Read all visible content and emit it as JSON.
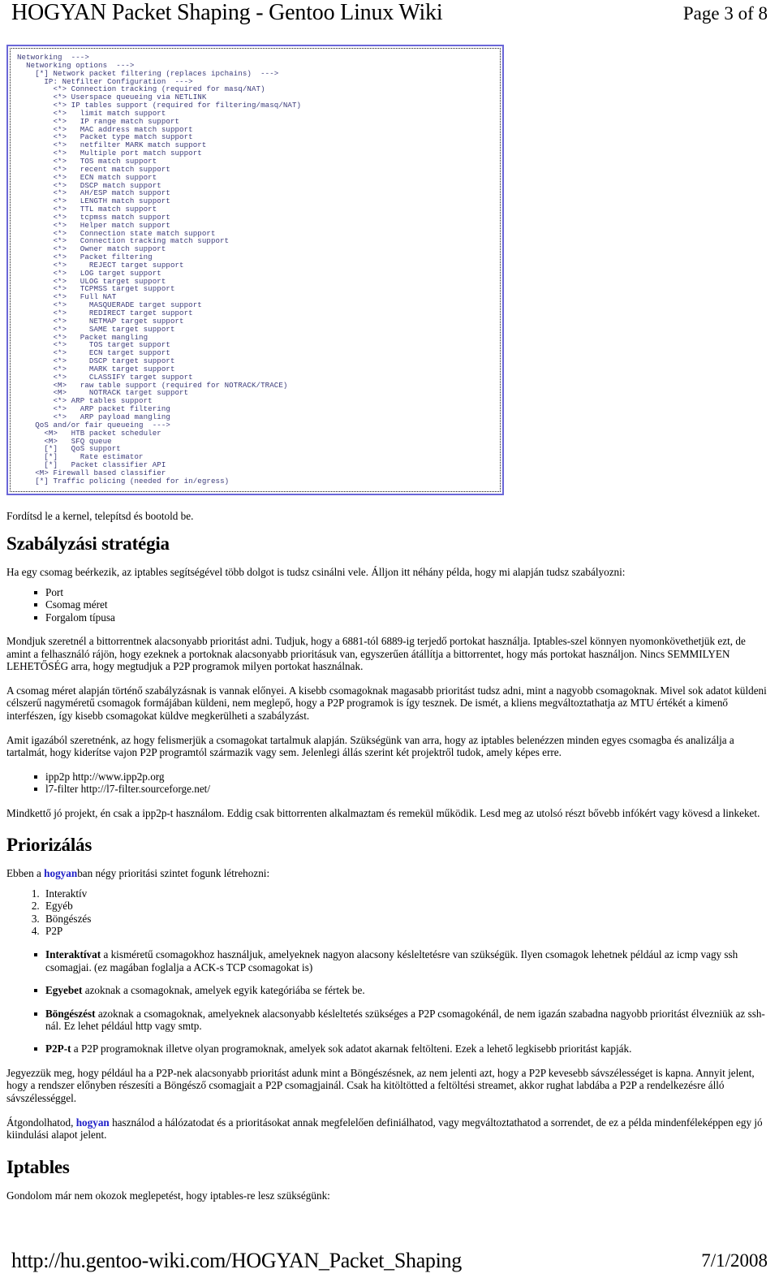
{
  "header": {
    "title": "HOGYAN Packet Shaping - Gentoo Linux Wiki",
    "page_label": "Page 3 of 8"
  },
  "codeblock": {
    "name": "kernel-menuconfig-listing",
    "text_color": "#3b3b7a",
    "border_color": "#6a66d8",
    "content": "Networking  --->\n  Networking options  --->\n    [*] Network packet filtering (replaces ipchains)  --->\n      IP: Netfilter Configuration  --->\n        <*> Connection tracking (required for masq/NAT)\n        <*> Userspace queueing via NETLINK\n        <*> IP tables support (required for filtering/masq/NAT)\n        <*>   limit match support\n        <*>   IP range match support\n        <*>   MAC address match support\n        <*>   Packet type match support\n        <*>   netfilter MARK match support\n        <*>   Multiple port match support\n        <*>   TOS match support\n        <*>   recent match support\n        <*>   ECN match support\n        <*>   DSCP match support\n        <*>   AH/ESP match support\n        <*>   LENGTH match support\n        <*>   TTL match support\n        <*>   tcpmss match support\n        <*>   Helper match support\n        <*>   Connection state match support\n        <*>   Connection tracking match support\n        <*>   Owner match support\n        <*>   Packet filtering\n        <*>     REJECT target support\n        <*>   LOG target support\n        <*>   ULOG target support\n        <*>   TCPMSS target support\n        <*>   Full NAT\n        <*>     MASQUERADE target support\n        <*>     REDIRECT target support\n        <*>     NETMAP target support\n        <*>     SAME target support\n        <*>   Packet mangling\n        <*>     TOS target support\n        <*>     ECN target support\n        <*>     DSCP target support\n        <*>     MARK target support\n        <*>     CLASSIFY target support\n        <M>   raw table support (required for NOTRACK/TRACE)\n        <M>     NOTRACK target support\n        <*> ARP tables support\n        <*>   ARP packet filtering\n        <*>   ARP payload mangling\n    QoS and/or fair queueing  --->\n      <M>   HTB packet scheduler\n      <M>   SFQ queue\n      [*]   QoS support\n      [*]     Rate estimator\n      [*]   Packet classifier API\n    <M> Firewall based classifier\n    [*] Traffic policing (needed for in/egress)"
  },
  "body": {
    "intro_line": "Fordítsd le a kernel, telepítsd és bootold be.",
    "section_strategy_heading": "Szabályzási stratégia",
    "strategy_intro": "Ha egy csomag beérkezik, az iptables segítségével több dolgot is tudsz csinálni vele. Álljon itt néhány példa, hogy mi alapján tudsz szabályozni:",
    "strategy_bullets": [
      "Port",
      "Csomag méret",
      "Forgalom típusa"
    ],
    "para_bittorrent": "Mondjuk szeretnél a bittorrentnek alacsonyabb prioritást adni. Tudjuk, hogy a 6881-tól 6889-ig terjedő portokat használja. Iptables-szel könnyen nyomonkövethetjük ezt, de amint a felhasználó rájön, hogy ezeknek a portoknak alacsonyabb prioritásuk van, egyszerűen átállítja a bittorrentet, hogy más portokat használjon. Nincs SEMMILYEN LEHETŐSÉG arra, hogy megtudjuk a P2P programok milyen portokat használnak.",
    "para_size": "A csomag méret alapján történő szabályzásnak is vannak előnyei. A kisebb csomagoknak magasabb prioritást tudsz adni, mint a nagyobb csomagoknak. Mivel sok adatot küldeni célszerű nagyméretű csomagok formájában küldeni, nem meglepő, hogy a P2P programok is így tesznek. De ismét, a kliens megváltoztathatja az MTU értékét a kimenő interfészen, így kisebb csomagokat küldve megkerülheti a szabályzást.",
    "para_content": "Amit igazából szeretnénk, az hogy felismerjük a csomagokat tartalmuk alapján. Szükségünk van arra, hogy az iptables belenézzen minden egyes csomagba és analizálja a tartalmát, hogy kiderítse vajon P2P programtól származik vagy sem. Jelenlegi állás szerint két projektről tudok, amely képes erre.",
    "project_bullets": [
      "ipp2p http://www.ipp2p.org",
      "l7-filter http://l7-filter.sourceforge.net/"
    ],
    "para_projects_note": "Mindkettő jó projekt, én csak a ipp2p-t használom. Eddig csak bittorrenten alkalmaztam és remekül működik. Lesd meg az utolsó részt bővebb infókért vagy kövesd a linkeket.",
    "section_priority_heading": "Priorizálás",
    "priority_intro_before": "Ebben a ",
    "priority_intro_link": "hogyan",
    "priority_intro_after": "ban négy prioritási szintet fogunk létrehozni:",
    "priority_levels": [
      "Interaktív",
      "Egyéb",
      "Böngészés",
      "P2P"
    ],
    "priority_defs": [
      {
        "term": "Interaktívat",
        "text": " a kisméretű csomagokhoz használjuk, amelyeknek nagyon alacsony késleltetésre van szükségük. Ilyen csomagok lehetnek például az icmp vagy ssh csomagjai. (ez magában foglalja a ACK-s TCP csomagokat is)"
      },
      {
        "term": "Egyebet",
        "text": " azoknak a csomagoknak, amelyek egyik kategóriába se fértek be."
      },
      {
        "term": "Böngészést",
        "text": " azoknak a csomagoknak, amelyeknek alacsonyabb késleltetés szükséges a P2P csomagokénál, de nem igazán szabadna nagyobb prioritást élvezniük az ssh-nál. Ez lehet például http vagy smtp."
      },
      {
        "term": "P2P-t",
        "text": " a P2P programoknak illetve olyan programoknak, amelyek sok adatot akarnak feltölteni. Ezek a lehető legkisebb prioritást kapják."
      }
    ],
    "para_bandwidth": "Jegyezzük meg, hogy például ha a P2P-nek alacsonyabb prioritást adunk mint a Böngészésnek, az nem jelenti azt, hogy a P2P kevesebb sávszélességet is kapna. Annyit jelent, hogy a rendszer előnyben részesíti a Böngésző csomagjait a P2P csomagjainál. Csak ha kitöltötted a feltöltési streamet, akkor rughat labdába a P2P a rendelkezésre álló sávszélességgel.",
    "para_rethink_before": "Átgondolhatod, ",
    "para_rethink_link": "hogyan",
    "para_rethink_after": " használod a hálózatodat és a prioritásokat annak megfelelően definiálhatod, vagy megváltoztathatod a sorrendet, de ez a példa mindenféleképpen egy jó kiindulási alapot jelent.",
    "section_iptables_heading": "Iptables",
    "para_iptables": "Gondolom már nem okozok meglepetést, hogy iptables-re lesz szükségünk:"
  },
  "footer": {
    "url": "http://hu.gentoo-wiki.com/HOGYAN_Packet_Shaping",
    "date": "7/1/2008"
  }
}
